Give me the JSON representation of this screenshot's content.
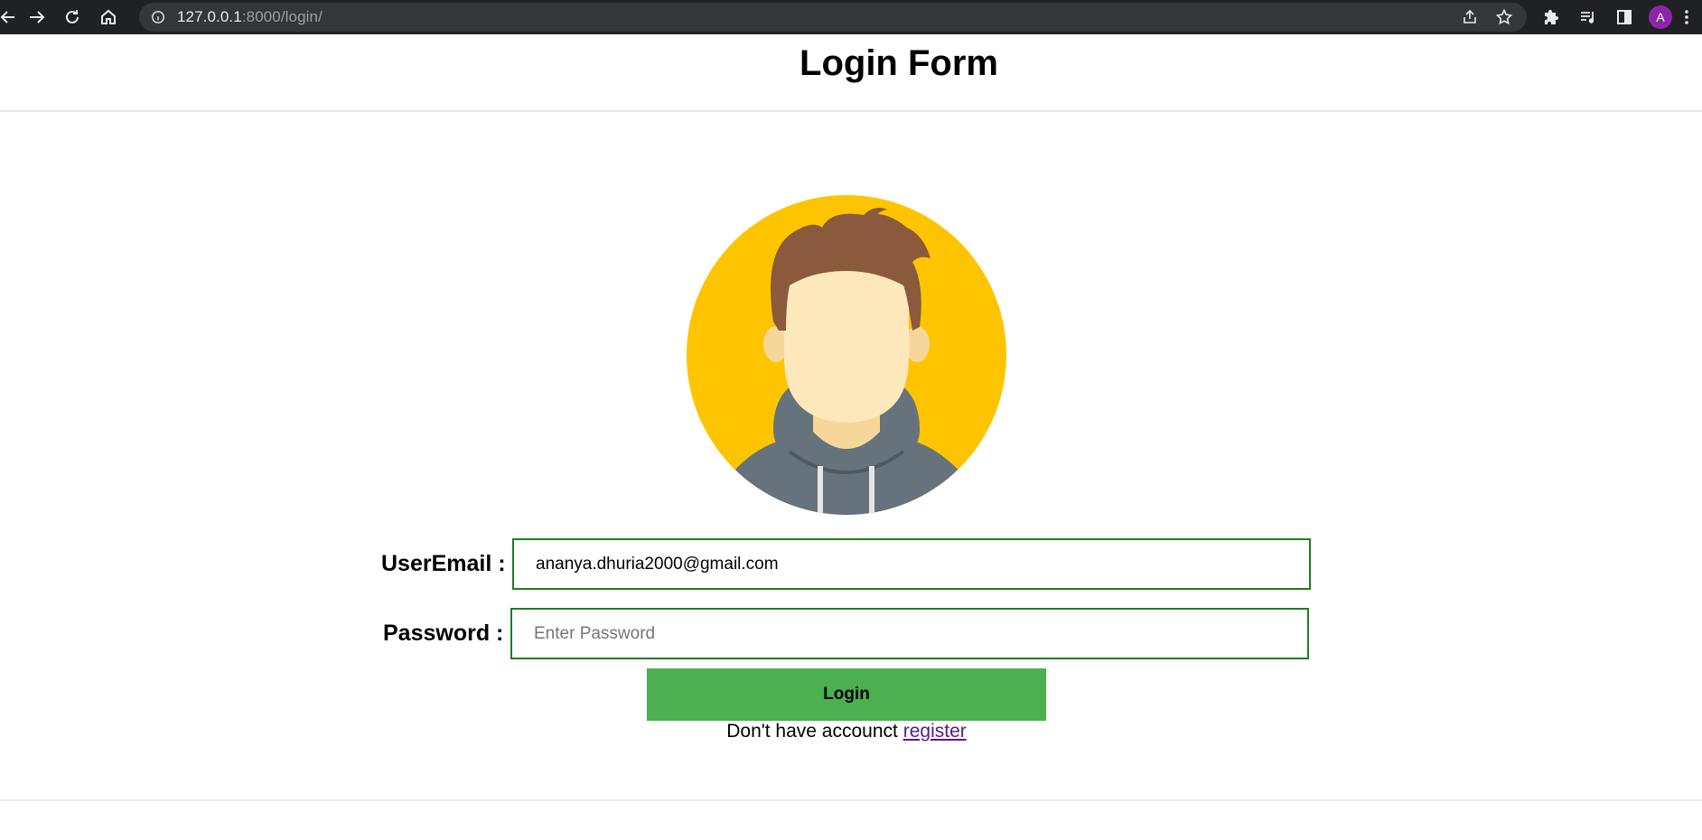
{
  "browser": {
    "url_host": "127.0.0.1",
    "url_path": ":8000/login/",
    "profile_initial": "A"
  },
  "page": {
    "title": "Login Form"
  },
  "form": {
    "email_label": "UserEmail :",
    "email_value": "ananya.dhuria2000@gmail.com",
    "password_label": "Password :",
    "password_placeholder": "Enter Password",
    "login_label": "Login",
    "register_prompt": "Don't have accounct",
    "register_link": "register"
  },
  "colors": {
    "avatar_bg": "#ffc400",
    "input_border": "#1e7d1e",
    "button_bg": "#4caf50",
    "link": "#551a8b"
  },
  "icons": {
    "back": "arrow-left-icon",
    "forward": "arrow-right-icon",
    "reload": "reload-icon",
    "home": "home-icon",
    "site_info": "info-icon",
    "share": "share-icon",
    "bookmark": "star-icon",
    "extensions": "puzzle-icon",
    "media": "playlist-icon",
    "side_panel": "side-panel-icon",
    "menu": "kebab-menu-icon",
    "avatar_image": "user-avatar-illustration"
  }
}
